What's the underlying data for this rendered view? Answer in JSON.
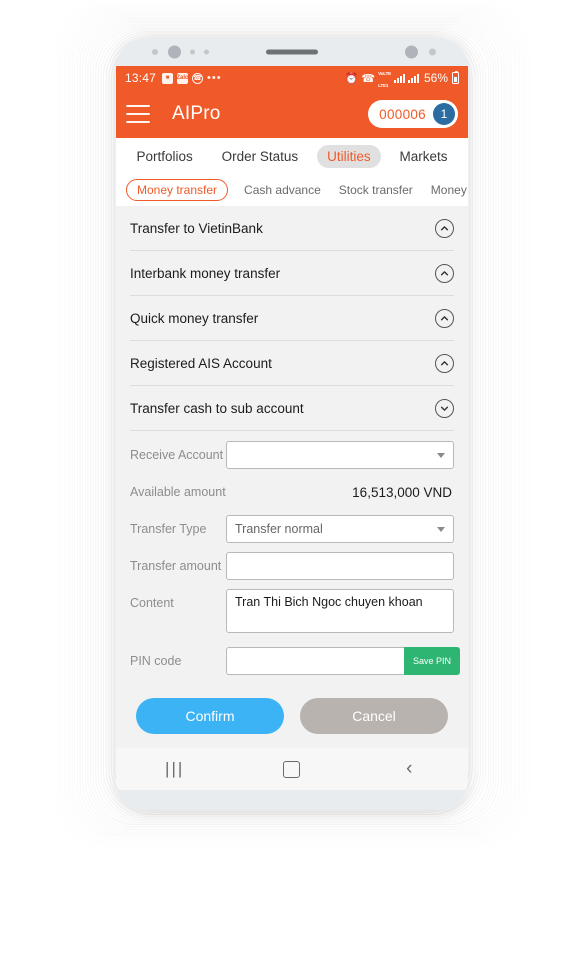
{
  "status_bar": {
    "time": "13:47",
    "left_icons": [
      "gallery-icon",
      "zalo-icon",
      "viber-icon"
    ],
    "overflow": "•••",
    "right_icons": [
      "alarm-icon",
      "wifi-icon",
      "volte-icon",
      "signal-icon",
      "signal-icon"
    ],
    "volte_top": "VoLTE",
    "volte_bottom": "LTE1",
    "battery_percent": "56%"
  },
  "header": {
    "menu_icon": "hamburger-menu-icon",
    "title": "AIPro",
    "account_number": "000006",
    "account_count": "1"
  },
  "main_tabs": [
    {
      "label": "Portfolios",
      "active": false
    },
    {
      "label": "Order Status",
      "active": false
    },
    {
      "label": "Utilities",
      "active": true
    },
    {
      "label": "Markets",
      "active": false
    }
  ],
  "sub_tabs": [
    {
      "label": "Money transfer",
      "active": true
    },
    {
      "label": "Cash advance",
      "active": false
    },
    {
      "label": "Stock transfer",
      "active": false
    },
    {
      "label": "Money",
      "active": false
    }
  ],
  "accordion": [
    {
      "label": "Transfer to VietinBank",
      "icon": "chevron-up-icon",
      "expanded": false
    },
    {
      "label": "Interbank money transfer",
      "icon": "chevron-up-icon",
      "expanded": false
    },
    {
      "label": "Quick money transfer",
      "icon": "chevron-up-icon",
      "expanded": false
    },
    {
      "label": "Registered AIS Account",
      "icon": "chevron-up-icon",
      "expanded": false
    },
    {
      "label": "Transfer cash to sub account",
      "icon": "chevron-down-icon",
      "expanded": true
    }
  ],
  "form": {
    "receive_account": {
      "label": "Receive Account",
      "value": "",
      "placeholder": ""
    },
    "available_amount": {
      "label": "Available amount",
      "value": "16,513,000 VND"
    },
    "transfer_type": {
      "label": "Transfer Type",
      "value": "Transfer normal"
    },
    "transfer_amount": {
      "label": "Transfer amount",
      "value": "",
      "placeholder": ""
    },
    "content": {
      "label": "Content",
      "value": "Tran Thi Bich Ngoc chuyen khoan",
      "placeholder": ""
    },
    "pin_code": {
      "label": "PIN code",
      "value": "",
      "placeholder": "",
      "save_label": "Save PIN"
    }
  },
  "actions": {
    "confirm_label": "Confirm",
    "cancel_label": "Cancel"
  },
  "nav_bar": {
    "recents": "|||",
    "home_icon": "home-square-icon",
    "back": "‹"
  },
  "colors": {
    "brand_orange": "#f05a28",
    "confirm_blue": "#3bb3f5",
    "cancel_gray": "#b8b3af",
    "save_pin_green": "#2fb572",
    "badge_blue": "#2b6ca3"
  }
}
